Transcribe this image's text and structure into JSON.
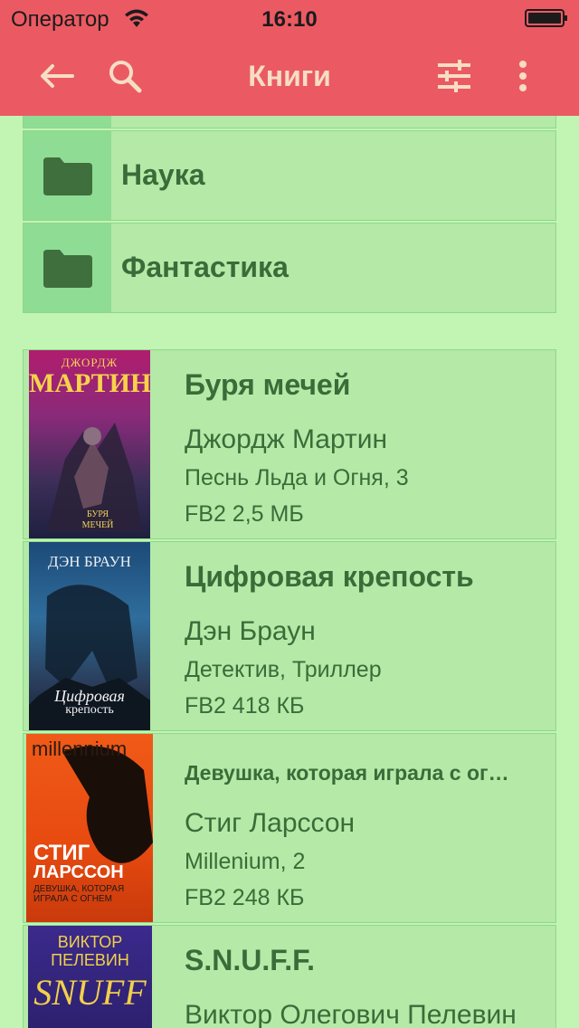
{
  "status_bar": {
    "carrier": "Оператор",
    "time": "16:10"
  },
  "nav": {
    "title": "Книги",
    "icons": [
      "back-arrow-icon",
      "search-icon",
      "filter-sliders-icon",
      "more-vertical-icon"
    ]
  },
  "colors": {
    "header": "#eb5a63",
    "background": "#c2f5b4",
    "row": "#b5e9a7",
    "accent_text": "#3a6c39",
    "title_text": "#f6ddc4"
  },
  "folders": [
    {
      "label": "Наука"
    },
    {
      "label": "Фантастика"
    }
  ],
  "books": [
    {
      "title": "Буря мечей",
      "author": "Джордж Мартин",
      "series": "Песнь Льда и Огня, 3",
      "meta": "FB2 2,5 МБ",
      "cover": {
        "line1": "ДЖОРДЖ",
        "line2": "МАРТИН",
        "line3": "БУРЯ",
        "line4": "МЕЧЕЙ"
      }
    },
    {
      "title": "Цифровая крепость",
      "author": "Дэн Браун",
      "series": "Детектив, Триллер",
      "meta": "FB2 418 КБ",
      "cover": {
        "line1": "ДЭН БРАУН",
        "line2": "Цифровая",
        "line3": "крепость"
      }
    },
    {
      "title": "Девушка, которая играла с огнем",
      "author": "Стиг Ларссон",
      "series": "Millenium, 2",
      "meta": "FB2 248 КБ",
      "cover": {
        "line1": "millennium",
        "line2": "СТИГ",
        "line3": "ЛАРССОН",
        "line4": "ДЕВУШКА, КОТОРАЯ ИГРАЛА С ОГНЕМ"
      }
    },
    {
      "title": "S.N.U.F.F.",
      "author": "Виктор Олегович Пелевин",
      "cover": {
        "line1": "ВИКТОР",
        "line2": "ПЕЛЕВИН",
        "line3": "SNUFF"
      }
    }
  ]
}
